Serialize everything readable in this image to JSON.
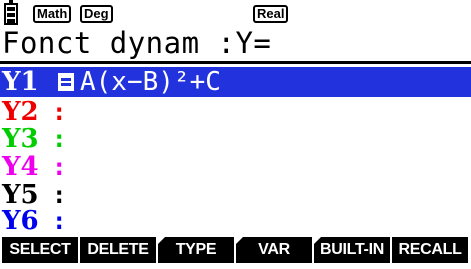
{
  "status_bar": {
    "mode_math": "Math",
    "mode_angle": "Deg",
    "mode_complex": "Real",
    "battery_icon": "battery-icon"
  },
  "title": {
    "text": "Fonct dynam :Y="
  },
  "functions": [
    {
      "label": "Y1",
      "color": "#000000",
      "expression": "A(x−B)²+C",
      "selected": true
    },
    {
      "label": "Y2",
      "color": "#ee0000",
      "expression": "",
      "selected": false
    },
    {
      "label": "Y3",
      "color": "#00cc00",
      "expression": "",
      "selected": false
    },
    {
      "label": "Y4",
      "color": "#ee00ee",
      "expression": "",
      "selected": false
    },
    {
      "label": "Y5",
      "color": "#000000",
      "expression": "",
      "selected": false
    },
    {
      "label": "Y6",
      "color": "#0000ee",
      "expression": "",
      "selected": false
    }
  ],
  "softkeys": [
    "SELECT",
    "DELETE",
    "TYPE",
    "VAR",
    "BUILT-IN",
    "RECALL"
  ],
  "colors": {
    "highlight": "#2233dd",
    "background": "#ffffff",
    "softkey_bg": "#000000"
  }
}
